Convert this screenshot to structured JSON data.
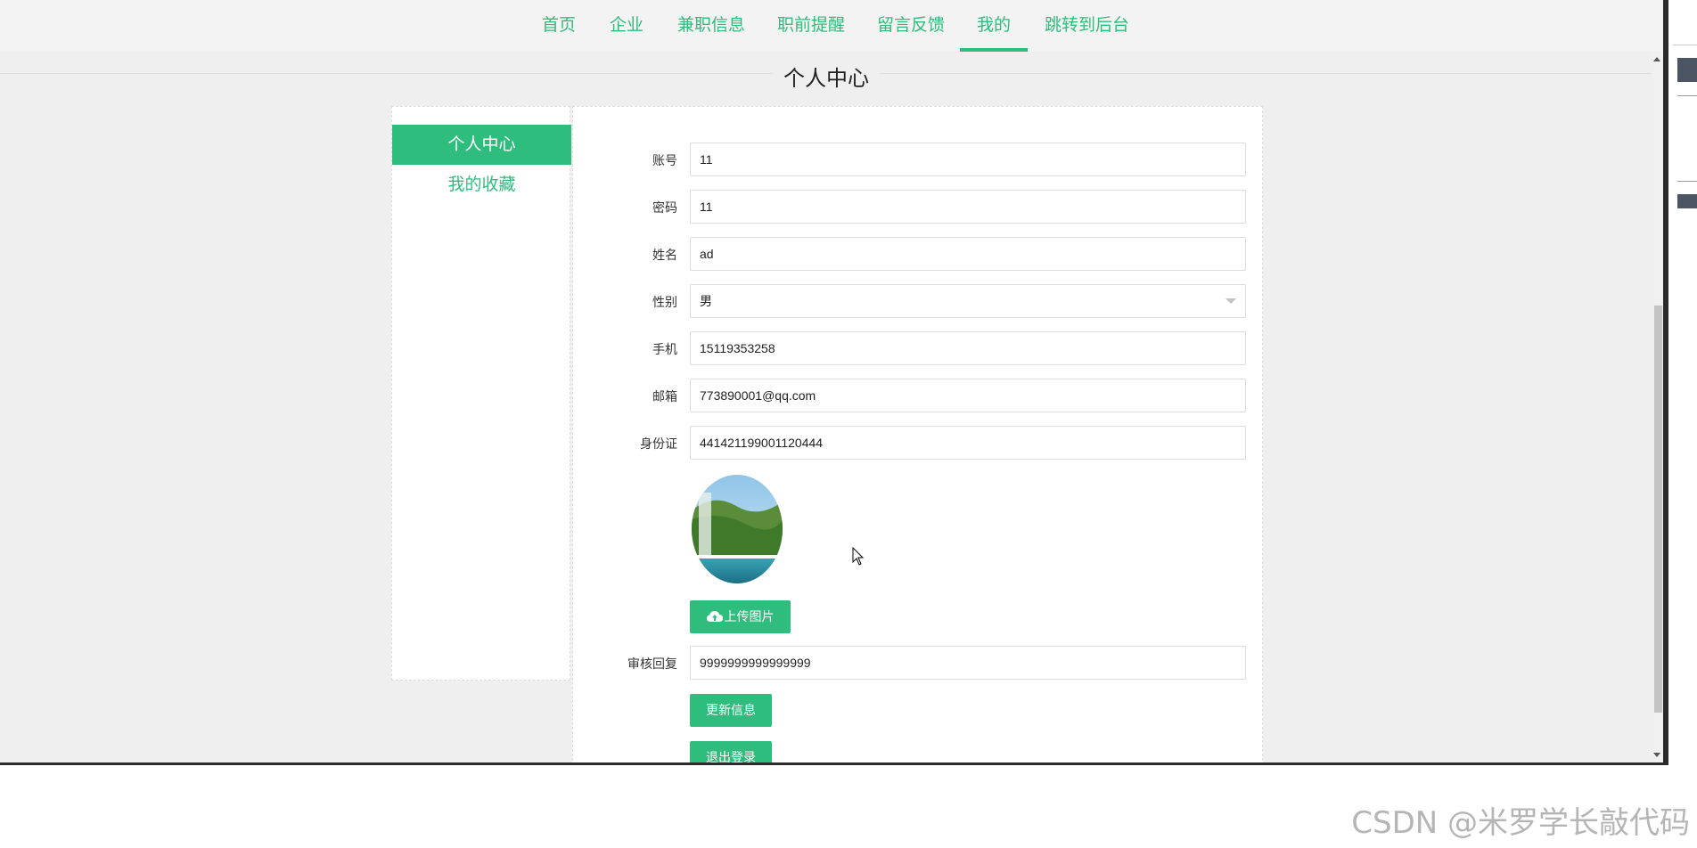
{
  "nav": {
    "items": [
      {
        "label": "首页"
      },
      {
        "label": "企业"
      },
      {
        "label": "兼职信息"
      },
      {
        "label": "职前提醒"
      },
      {
        "label": "留言反馈"
      },
      {
        "label": "我的"
      },
      {
        "label": "跳转到后台"
      }
    ],
    "active": "我的"
  },
  "page_title": "个人中心",
  "sidebar": {
    "items": [
      {
        "label": "个人中心",
        "active": true
      },
      {
        "label": "我的收藏",
        "active": false
      }
    ]
  },
  "form": {
    "account": {
      "label": "账号",
      "value": "11"
    },
    "password": {
      "label": "密码",
      "value": "11"
    },
    "name": {
      "label": "姓名",
      "value": "ad"
    },
    "gender": {
      "label": "性别",
      "value": "男"
    },
    "phone": {
      "label": "手机",
      "value": "15119353258"
    },
    "email": {
      "label": "邮箱",
      "value": "773890001@qq.com"
    },
    "id_card": {
      "label": "身份证",
      "value": "441421199001120444"
    },
    "upload_label": "上传图片",
    "review_reply": {
      "label": "审核回复",
      "value": "9999999999999999"
    },
    "update_label": "更新信息",
    "logout_label": "退出登录"
  },
  "watermark": "CSDN @米罗学长敲代码",
  "colors": {
    "accent": "#2ebd7c",
    "background": "#efefef"
  }
}
